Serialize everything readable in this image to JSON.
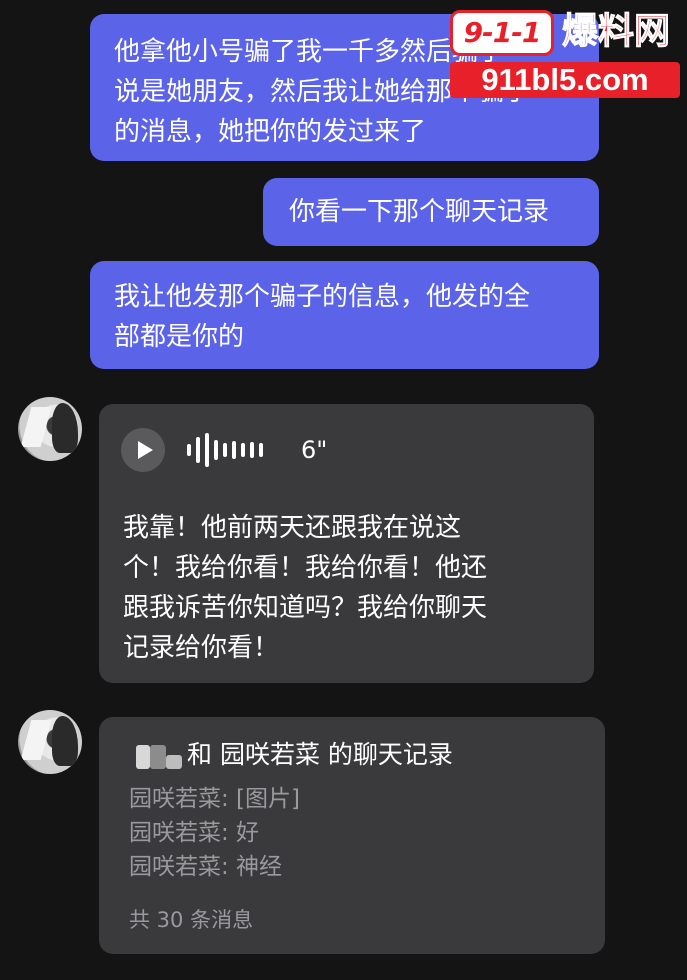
{
  "messages_outgoing": [
    {
      "lines": [
        "他拿他小号骗了我一千多然后骗了",
        "说是她朋友，然后我让她给那个骗子",
        "的消息，她把你的发过来了"
      ]
    },
    {
      "lines": [
        "你看一下那个聊天记录"
      ]
    },
    {
      "lines": [
        "我让他发那个骗子的信息，他发的全",
        "部都是你的"
      ]
    }
  ],
  "voice_message": {
    "duration": "6\"",
    "transcript_lines": [
      "我靠！他前两天还跟我在说这",
      "个！我给你看！我给你看！他还",
      "跟我诉苦你知道吗？我给你聊天",
      "记录给你看！"
    ]
  },
  "forwarded_chat": {
    "title_suffix": "和 园咲若菜 的聊天记录",
    "lines": [
      "园咲若菜: [图片]",
      "园咲若菜: 好",
      "园咲若菜: 神经"
    ],
    "footer": "共 30 条消息"
  },
  "watermark": {
    "logo": "9-1-1",
    "brand": "爆料网",
    "url": "911bl5.com"
  },
  "colors": {
    "background": "#141414",
    "outgoing_bubble": "#5b63e8",
    "incoming_bubble": "#3a3a3c",
    "muted_text": "#9a9a9e",
    "watermark_red": "#e8202a"
  },
  "icons": {
    "play": "play-icon",
    "waveform": "voice-waveform-icon",
    "avatar": "contact-avatar"
  }
}
